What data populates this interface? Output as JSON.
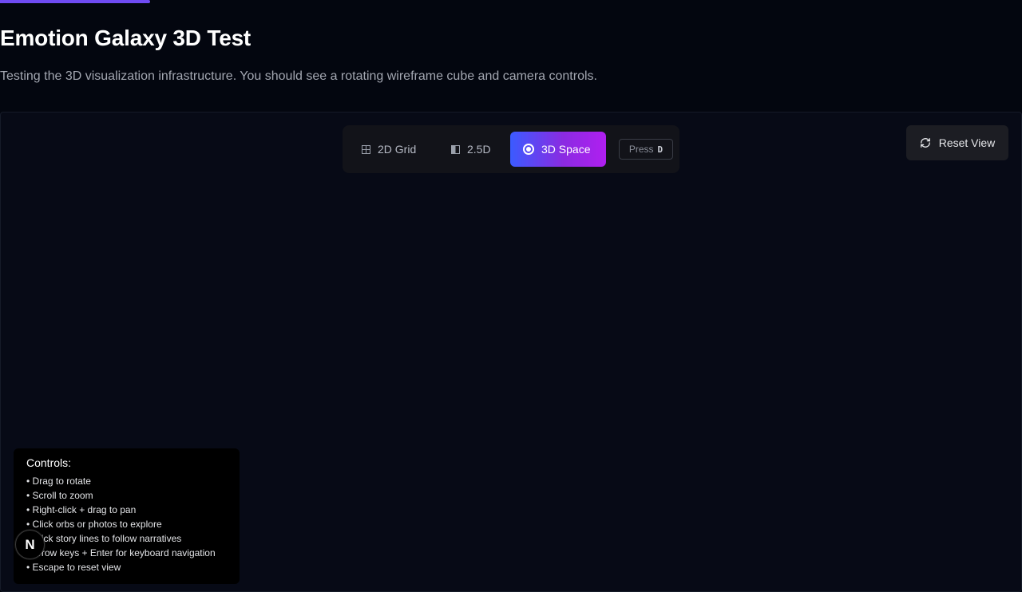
{
  "page": {
    "title": "Emotion Galaxy 3D Test",
    "subtitle": "Testing the 3D visualization infrastructure. You should see a rotating wireframe cube and camera controls."
  },
  "view_modes": {
    "items": [
      {
        "label": "2D Grid",
        "icon": "grid-icon",
        "active": false
      },
      {
        "label": "2.5D",
        "icon": "half-square-icon",
        "active": false
      },
      {
        "label": "3D Space",
        "icon": "radio-dot-icon",
        "active": true
      }
    ],
    "hint_prefix": "Press",
    "hint_key": "D"
  },
  "reset": {
    "label": "Reset View",
    "icon": "refresh-icon"
  },
  "controls": {
    "heading": "Controls:",
    "items": [
      "• Drag to rotate",
      "• Scroll to zoom",
      "• Right-click + drag to pan",
      "• Click orbs or photos to explore",
      "• Click story lines to follow narratives",
      "• Arrow keys + Enter for keyboard navigation",
      "• Escape to reset view"
    ]
  },
  "badge": {
    "letter": "N"
  },
  "colors": {
    "accent_start": "#3b5bff",
    "accent_end": "#b01ff0",
    "top_progress": "#6f4bf2",
    "background": "#03060f"
  }
}
